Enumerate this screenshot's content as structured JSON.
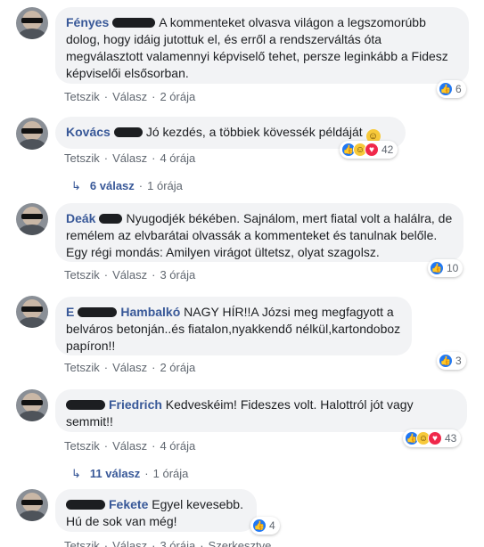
{
  "comments": [
    {
      "author": "Fényes",
      "text": "A kommenteket olvasva világon a legszomorúbb dolog, hogy idáig jutottuk el, és erről a rendszerváltás óta megválasztott valamennyi képviselő tehet, persze leginkább a Fidesz képviselői elsősorban.",
      "like_label": "Tetszik",
      "reply_label": "Válasz",
      "time": "2 órája",
      "reaction_count": "6"
    },
    {
      "author": "Kovács",
      "text": "Jó kezdés, a többiek kövessék példáját",
      "emoji": "smile-emoji",
      "like_label": "Tetszik",
      "reply_label": "Válasz",
      "time": "4 órája",
      "reaction_count": "42",
      "replies_label": "6 válasz",
      "replies_time": "1 órája"
    },
    {
      "author": "Deák",
      "text": "Nyugodjék békében. Sajnálom, mert fiatal volt a halálra, de remélem az elvbarátai olvassák a kommenteket és tanulnak belőle. Egy régi mondás: Amilyen virágot ültetsz, olyat szagolsz.",
      "like_label": "Tetszik",
      "reply_label": "Válasz",
      "time": "3 órája",
      "reaction_count": "10"
    },
    {
      "author_prefix": "E",
      "author": "Hambalkó",
      "text": "NAGY HÍR!!A Józsi meg megfagyott a belváros betonján..és fiatalon,nyakkendő nélkül,kartondoboz papíron!!",
      "like_label": "Tetszik",
      "reply_label": "Válasz",
      "time": "2 órája",
      "reaction_count": "3"
    },
    {
      "author": "Friedrich",
      "text": "Kedveskéim! Fideszes volt. Halottról jót vagy semmit!!",
      "like_label": "Tetszik",
      "reply_label": "Válasz",
      "time": "4 órája",
      "reaction_count": "43",
      "replies_label": "11 válasz",
      "replies_time": "1 órája"
    },
    {
      "author": "Fekete",
      "text": "Egyel kevesebb. Hú de sok van még!",
      "like_label": "Tetszik",
      "reply_label": "Válasz",
      "time": "3 órája",
      "edited_label": "Szerkesztve",
      "reaction_count": "4"
    }
  ],
  "icons": {
    "like": "like-icon",
    "haha": "haha-icon",
    "love": "love-icon",
    "reply_arrow": "reply-arrow-icon"
  },
  "colors": {
    "author": "#385898",
    "bubble": "#f2f3f5",
    "meta": "#606770",
    "like": "#2078f4"
  }
}
